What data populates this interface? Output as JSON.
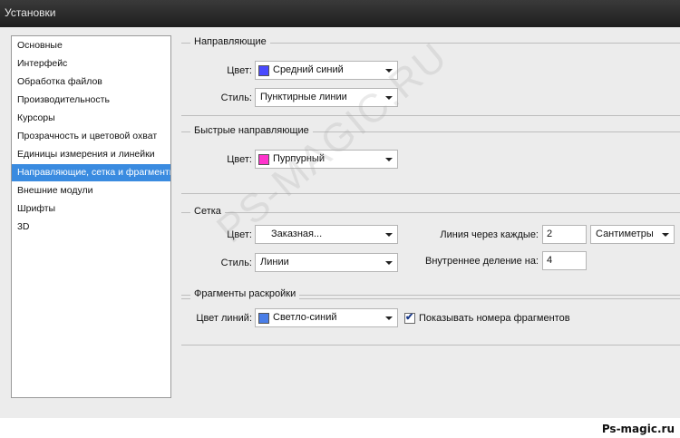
{
  "window": {
    "title": "Установки"
  },
  "sidebar": {
    "items": [
      {
        "label": "Основные",
        "selected": false
      },
      {
        "label": "Интерфейс",
        "selected": false
      },
      {
        "label": "Обработка файлов",
        "selected": false
      },
      {
        "label": "Производительность",
        "selected": false
      },
      {
        "label": "Курсоры",
        "selected": false
      },
      {
        "label": "Прозрачность и цветовой охват",
        "selected": false
      },
      {
        "label": "Единицы измерения и линейки",
        "selected": false
      },
      {
        "label": "Направляющие, сетка и фрагменты",
        "selected": true
      },
      {
        "label": "Внешние модули",
        "selected": false
      },
      {
        "label": "Шрифты",
        "selected": false
      },
      {
        "label": "3D",
        "selected": false
      }
    ]
  },
  "guides": {
    "title": "Направляющие",
    "color_label": "Цвет:",
    "color_value": "Средний синий",
    "color_swatch": "#4a4aff",
    "style_label": "Стиль:",
    "style_value": "Пунктирные линии"
  },
  "smart_guides": {
    "title": "Быстрые направляющие",
    "color_label": "Цвет:",
    "color_value": "Пурпурный",
    "color_swatch": "#ff33cc"
  },
  "grid": {
    "title": "Сетка",
    "color_label": "Цвет:",
    "color_value": "Заказная...",
    "style_label": "Стиль:",
    "style_value": "Линии",
    "gridline_label": "Линия через каждые:",
    "gridline_value": "2",
    "gridline_unit": "Сантиметры",
    "subdiv_label": "Внутреннее деление на:",
    "subdiv_value": "4"
  },
  "slices": {
    "title": "Фрагменты раскройки",
    "line_color_label": "Цвет линий:",
    "line_color_value": "Светло-синий",
    "line_color_swatch": "#4a7ee8",
    "show_numbers_label": "Показывать номера фрагментов",
    "show_numbers_checked": true
  },
  "watermark": "PS-MAGIC.RU",
  "footer": {
    "brand": "Ps-magic.ru"
  }
}
